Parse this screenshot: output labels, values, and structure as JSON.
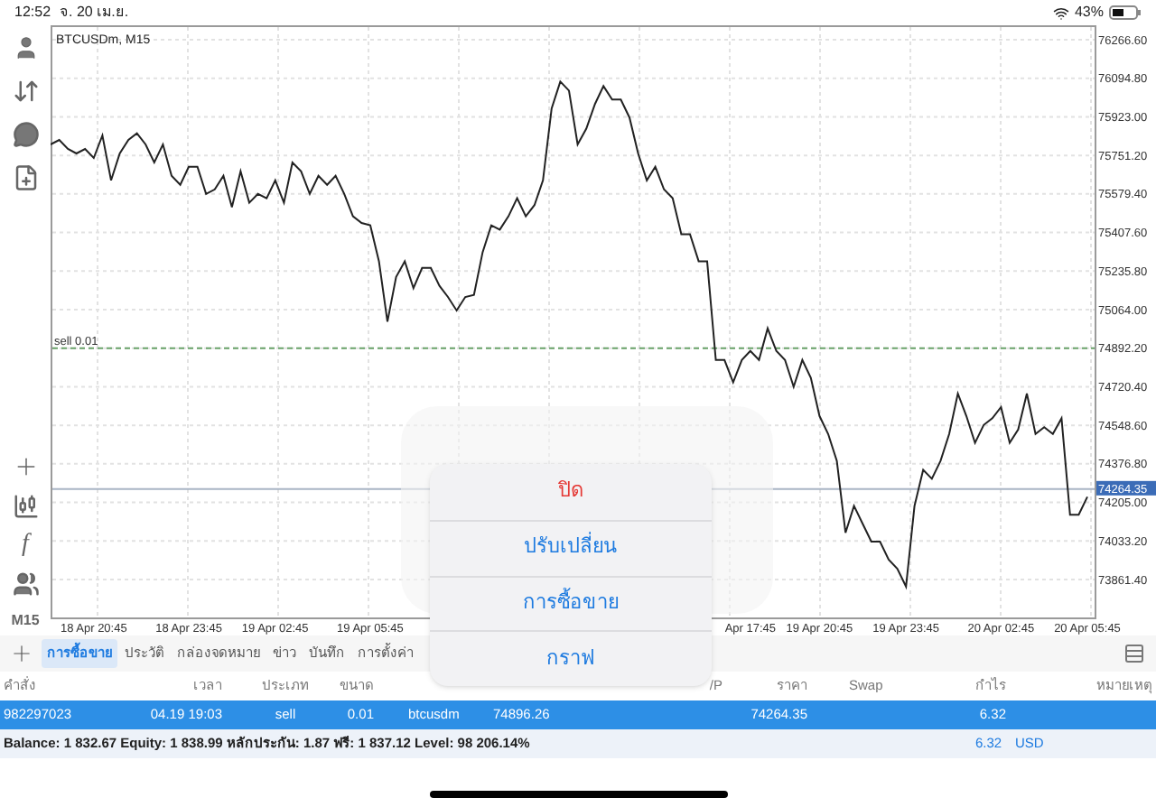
{
  "status_bar": {
    "time": "12:52",
    "date": "จ. 20 เม.ย.",
    "battery": "43%"
  },
  "toolbar": {
    "function_label": "f",
    "timeframe": "M15"
  },
  "chart": {
    "title": "BTCUSDm, M15",
    "chart_data": {
      "type": "line",
      "grid": true,
      "categories": [
        null,
        null,
        null,
        null,
        null,
        "18 Apr 20:45",
        null,
        null,
        null,
        null,
        null,
        null,
        null,
        null,
        null,
        null,
        "18 Apr 23:45",
        null,
        null,
        null,
        null,
        null,
        null,
        null,
        null,
        null,
        "19 Apr 02:45",
        null,
        null,
        null,
        null,
        null,
        null,
        null,
        null,
        null,
        null,
        "19 Apr 05:45",
        null,
        null,
        null,
        null,
        null,
        null,
        null,
        null,
        null,
        null,
        null,
        null,
        null,
        null,
        null,
        null,
        null,
        null,
        null,
        null,
        null,
        null,
        null,
        null,
        null,
        null,
        null,
        null,
        null,
        null,
        null,
        null,
        null,
        null,
        null,
        null,
        null,
        null,
        null,
        null,
        null,
        null,
        null,
        "Apr 17:45",
        null,
        null,
        null,
        null,
        null,
        null,
        null,
        "19 Apr 20:45",
        null,
        null,
        null,
        null,
        null,
        null,
        null,
        null,
        null,
        "19 Apr 23:45",
        null,
        null,
        null,
        null,
        null,
        null,
        null,
        null,
        null,
        null,
        "20 Apr 02:45",
        null,
        null,
        null,
        null,
        null,
        null,
        null,
        null,
        null,
        "20 Apr 05:45"
      ],
      "series": [
        {
          "color": "#222222",
          "values": [
            75800,
            75820,
            75780,
            75760,
            75780,
            75740,
            75840,
            75640,
            75760,
            75820,
            75850,
            75800,
            75720,
            75800,
            75660,
            75620,
            75700,
            75700,
            75580,
            75600,
            75660,
            75520,
            75680,
            75540,
            75580,
            75560,
            75640,
            75540,
            75720,
            75680,
            75580,
            75660,
            75620,
            75660,
            75580,
            75480,
            75450,
            75440,
            75280,
            75010,
            75210,
            75280,
            75160,
            75250,
            75250,
            75170,
            75120,
            75060,
            75120,
            75130,
            75320,
            75440,
            75420,
            75480,
            75560,
            75480,
            75530,
            75640,
            75960,
            76080,
            76040,
            75800,
            75870,
            75980,
            76060,
            76000,
            76000,
            75920,
            75760,
            75640,
            75700,
            75600,
            75560,
            75400,
            75400,
            75280,
            75280,
            74840,
            74840,
            74740,
            74840,
            74880,
            74840,
            74980,
            74880,
            74840,
            74720,
            74840,
            74760,
            74590,
            74510,
            74390,
            74070,
            74190,
            74110,
            74030,
            74030,
            73950,
            73910,
            73830,
            74190,
            74350,
            74310,
            74390,
            74510,
            74690,
            74590,
            74470,
            74550,
            74580,
            74630,
            74470,
            74530,
            74690,
            74510,
            74540,
            74510,
            74580,
            74150,
            74150,
            74230
          ]
        }
      ],
      "ylim": [
        73692.5,
        76331
      ],
      "yticks": [
        {
          "value": 76266.6,
          "label": "76266.60"
        },
        {
          "value": 76094.8,
          "label": "76094.80"
        },
        {
          "value": 75923,
          "label": "75923.00"
        },
        {
          "value": 75751.2,
          "label": "75751.20"
        },
        {
          "value": 75579.4,
          "label": "75579.40"
        },
        {
          "value": 75407.6,
          "label": "75407.60"
        },
        {
          "value": 75235.8,
          "label": "75235.80"
        },
        {
          "value": 75064,
          "label": "75064.00"
        },
        {
          "value": 74892.2,
          "label": "74892.20"
        },
        {
          "value": 74720.4,
          "label": "74720.40"
        },
        {
          "value": 74548.6,
          "label": "74548.60"
        },
        {
          "value": 74376.8,
          "label": "74376.80"
        },
        {
          "value": 74205,
          "label": "74205.00"
        },
        {
          "value": 74033.2,
          "label": "74033.20"
        },
        {
          "value": 73861.4,
          "label": "73861.40"
        }
      ],
      "ref_lines": [
        {
          "axis": "y",
          "value": 74892.2,
          "label": "sell 0.01",
          "color": "#6aa36a"
        },
        {
          "axis": "y",
          "value": 74264.35,
          "label": "74264.35",
          "color": "#a9b4c4"
        }
      ]
    }
  },
  "tabs": [
    {
      "label": "การซื้อขาย",
      "selected": true
    },
    {
      "label": "ประวัติ",
      "selected": false
    },
    {
      "label": "กล่องจดหมาย",
      "selected": false
    },
    {
      "label": "ข่าว",
      "selected": false
    },
    {
      "label": "บันทึก",
      "selected": false
    },
    {
      "label": "การตั้งค่า",
      "selected": false
    }
  ],
  "table": {
    "columns": [
      "คำสั่ง",
      "เวลา",
      "ประเภท",
      "ขนาด",
      "",
      "",
      "/P",
      "ราคา",
      "Swap",
      "กำไร",
      "หมายเหตุ"
    ],
    "rows": [
      {
        "selected": true,
        "cells": [
          "982297023",
          "04.19 19:03",
          "sell",
          "0.01",
          "btcusdm",
          "74896.26",
          "",
          "74264.35",
          "",
          "6.32",
          ""
        ]
      }
    ]
  },
  "summary": {
    "text": "Balance: 1 832.67 Equity: 1 838.99 หลักประกัน: 1.87 ฟรี: 1 837.12 Level: 98 206.14%",
    "profit": "6.32",
    "currency": "USD"
  },
  "dialog": {
    "actions": [
      {
        "label": "ปิด",
        "kind": "destructive"
      },
      {
        "label": "ปรับเปลี่ยน",
        "kind": "default"
      },
      {
        "label": "การซื้อขาย",
        "kind": "default"
      },
      {
        "label": "กราฟ",
        "kind": "default"
      }
    ]
  }
}
